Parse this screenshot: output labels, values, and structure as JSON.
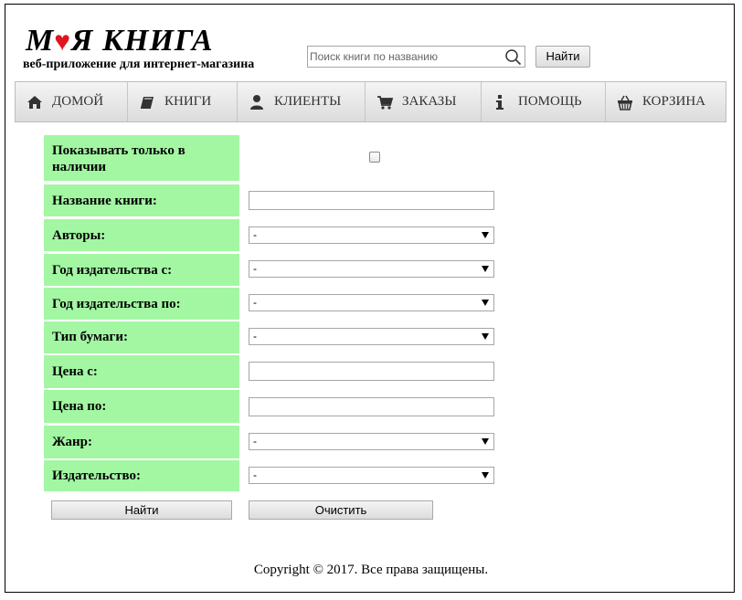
{
  "brand": {
    "title_part1": "М",
    "title_part2": "Я КНИГА",
    "subtitle": "веб-приложение для интернет-магазина",
    "heart_color": "#e0151f"
  },
  "search": {
    "placeholder": "Поиск книги по названию",
    "value": "",
    "button_label": "Найти",
    "icon": "search-icon"
  },
  "nav": {
    "items": [
      {
        "label": "ДОМОЙ",
        "icon": "home-icon"
      },
      {
        "label": "КНИГИ",
        "icon": "book-icon"
      },
      {
        "label": "КЛИЕНТЫ",
        "icon": "user-icon"
      },
      {
        "label": "ЗАКАЗЫ",
        "icon": "cart-icon"
      },
      {
        "label": "ПОМОЩЬ",
        "icon": "info-icon"
      },
      {
        "label": "КОРЗИНА",
        "icon": "basket-icon"
      }
    ]
  },
  "filter": {
    "label_bg": "#a3f7a3",
    "in_stock_label": "Показывать только в наличии",
    "in_stock_checked": false,
    "title_label": "Название книги:",
    "title_value": "",
    "authors_label": "Авторы:",
    "authors_value": "-",
    "year_from_label": "Год издательства с:",
    "year_from_value": "-",
    "year_to_label": "Год издательства по:",
    "year_to_value": "-",
    "paper_label": "Тип бумаги:",
    "paper_value": "-",
    "price_from_label": "Цена с:",
    "price_from_value": "",
    "price_to_label": "Цена по:",
    "price_to_value": "",
    "genre_label": "Жанр:",
    "genre_value": "-",
    "publisher_label": "Издательство:",
    "publisher_value": "-",
    "find_label": "Найти",
    "clear_label": "Очистить"
  },
  "footer": {
    "copyright": "Copyright © 2017. Все права защищены."
  }
}
